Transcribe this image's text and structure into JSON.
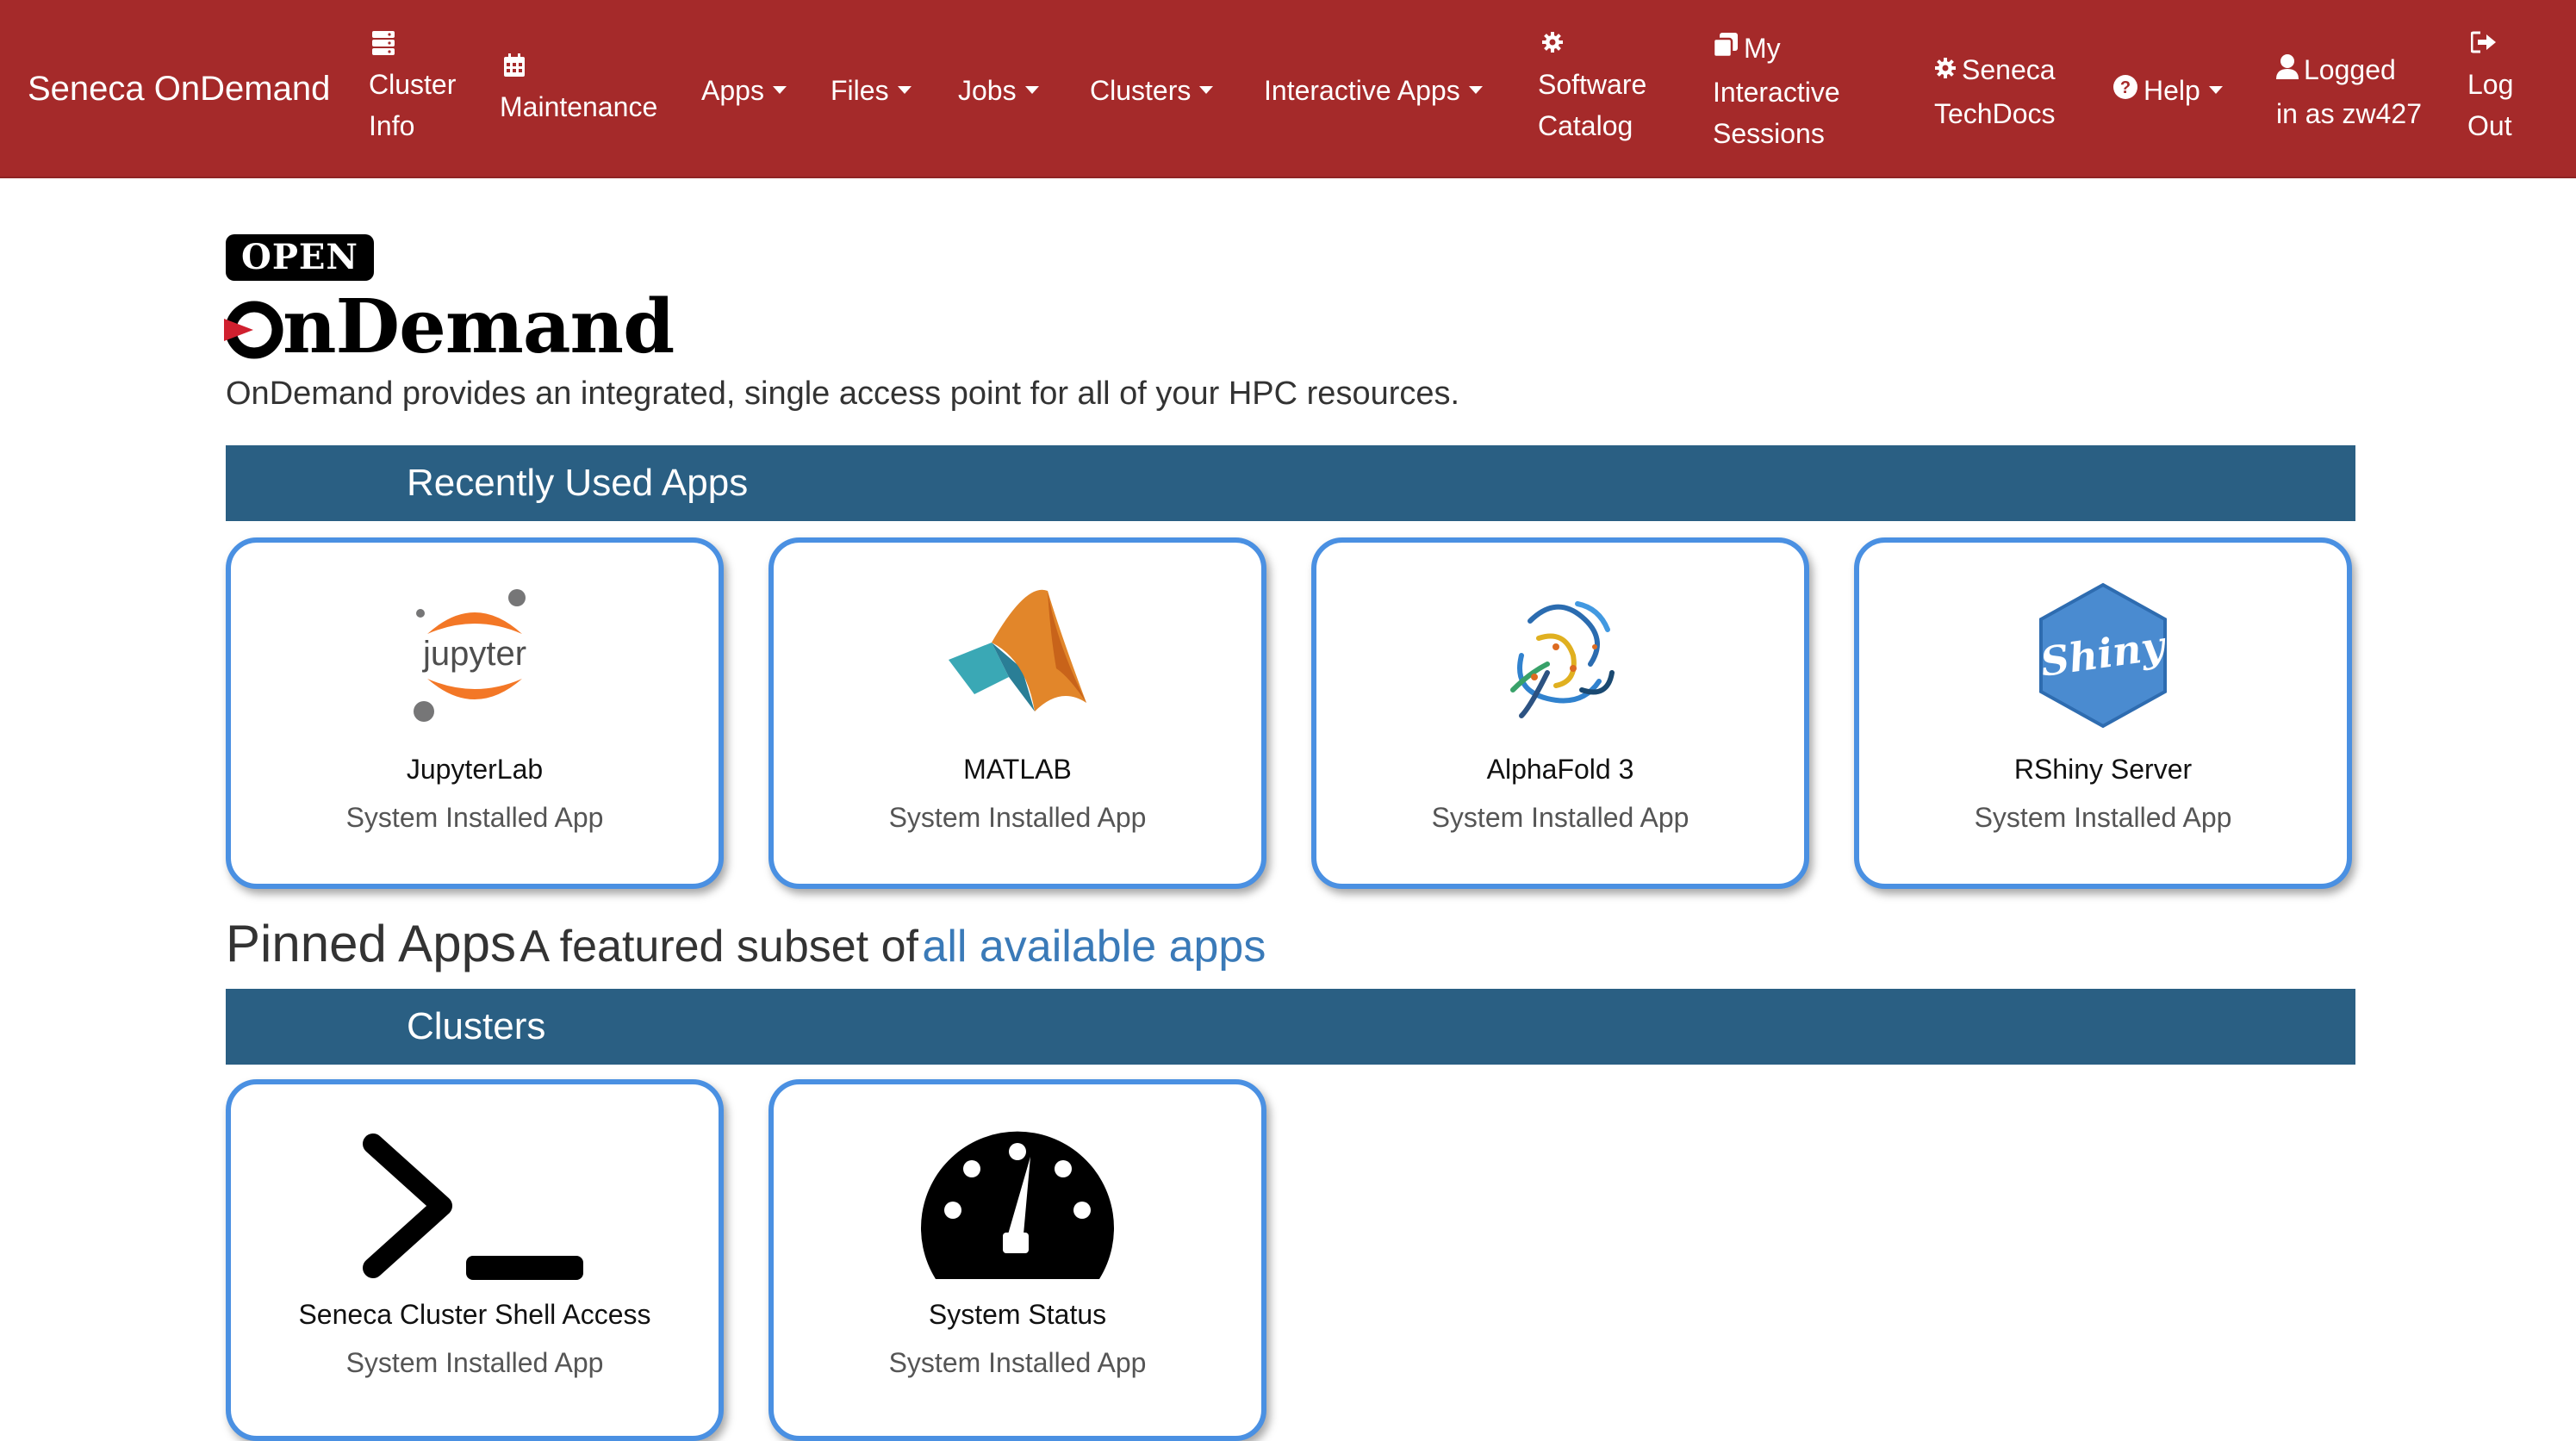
{
  "navbar": {
    "brand": "Seneca OnDemand",
    "items": {
      "cluster_info": {
        "line1": "Cluster",
        "line2": "Info",
        "icon": "server-icon"
      },
      "maintenance": {
        "label": "Maintenance",
        "icon": "calendar-icon"
      },
      "apps": {
        "label": "Apps"
      },
      "files": {
        "label": "Files"
      },
      "jobs": {
        "label": "Jobs"
      },
      "clusters": {
        "label": "Clusters"
      },
      "interactive_apps": {
        "label": "Interactive Apps"
      },
      "software_catalog": {
        "line1": "Software",
        "line2": "Catalog",
        "icon": "gear-icon"
      },
      "sessions": {
        "line1": "My",
        "line2": "Interactive",
        "line3": "Sessions",
        "icon": "clone-icon"
      },
      "techdocs": {
        "line1": "Seneca",
        "line2": "TechDocs",
        "icon": "gear-icon"
      },
      "help": {
        "label": "Help",
        "icon": "question-circle-icon"
      },
      "user": {
        "line1": "Logged",
        "line2": "in as zw427",
        "icon": "user-icon"
      },
      "logout": {
        "line1": "Log",
        "line2": "Out",
        "icon": "sign-out-icon"
      }
    },
    "color": "#a52a2a"
  },
  "logo": {
    "open": "OPEN",
    "wordmark": "nDemand"
  },
  "tagline": "OnDemand provides an integrated, single access point for all of your HPC resources.",
  "recent": {
    "heading": "Recently Used Apps",
    "apps": [
      {
        "title": "JupyterLab",
        "subtitle": "System Installed App",
        "icon": "jupyter-logo",
        "logo_text": "jupyter"
      },
      {
        "title": "MATLAB",
        "subtitle": "System Installed App",
        "icon": "matlab-logo"
      },
      {
        "title": "AlphaFold 3",
        "subtitle": "System Installed App",
        "icon": "protein-structure-image"
      },
      {
        "title": "RShiny Server",
        "subtitle": "System Installed App",
        "icon": "shiny-logo",
        "logo_text": "Shiny"
      }
    ]
  },
  "pinned": {
    "title": "Pinned Apps",
    "subtitle": "A featured subset of",
    "link": "all available apps"
  },
  "clusters": {
    "heading": "Clusters",
    "apps": [
      {
        "title": "Seneca Cluster Shell Access",
        "subtitle": "System Installed App",
        "icon": "terminal-icon"
      },
      {
        "title": "System Status",
        "subtitle": "System Installed App",
        "icon": "dashboard-gauge-icon"
      }
    ]
  },
  "colors": {
    "section_bar": "#2a5f83",
    "card_border": "#4a90e2",
    "link": "#3a7ab8"
  }
}
